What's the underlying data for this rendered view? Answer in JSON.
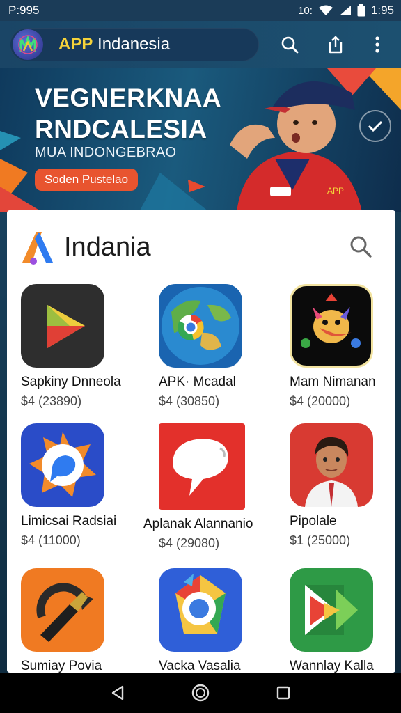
{
  "status_bar": {
    "left_text": "P:995",
    "network_text": "10:",
    "time": "1:95"
  },
  "app_bar": {
    "brand_accent": "APP",
    "brand_rest": " Indanesia",
    "icons": [
      "search-icon",
      "share-icon",
      "more-vert-icon"
    ]
  },
  "banner": {
    "title_line1": "VEGNERKNAA",
    "title_line2": "RNDCALESIA",
    "subtitle": "MUA INDONGEBRAO",
    "button_label": "Soden Pustelao",
    "accent_color": "#e8542f"
  },
  "store": {
    "title": "Indania",
    "apps": [
      {
        "name": "Sapkiny Dnneola",
        "price": "$4 (23890)",
        "icon": "play-store-icon"
      },
      {
        "name": "APK· Mcadal",
        "price": "$4 (30850)",
        "icon": "globe-chrome-icon"
      },
      {
        "name": "Mam Nimanan",
        "price": "$4 (20000)",
        "icon": "bird-mascot-icon"
      },
      {
        "name": "Limicsai Radsiai",
        "price": "$4 (11000)",
        "icon": "chat-star-icon"
      },
      {
        "name": "Aplanak Alannanio",
        "price": "$4 (29080)",
        "icon": "speech-bubble-icon"
      },
      {
        "name": "Pipolale",
        "price": "$1 (25000)",
        "icon": "student-avatar-icon"
      },
      {
        "name": "Sumiay Povia",
        "price": "",
        "icon": "champagne-refresh-icon"
      },
      {
        "name": "Vacka Vasalia",
        "price": "",
        "icon": "chrome-star-icon"
      },
      {
        "name": "Wannlay Kalla",
        "price": "",
        "icon": "green-play-icon"
      }
    ]
  },
  "nav_bar": {
    "icons": [
      "back-icon",
      "home-icon",
      "recents-icon"
    ]
  }
}
